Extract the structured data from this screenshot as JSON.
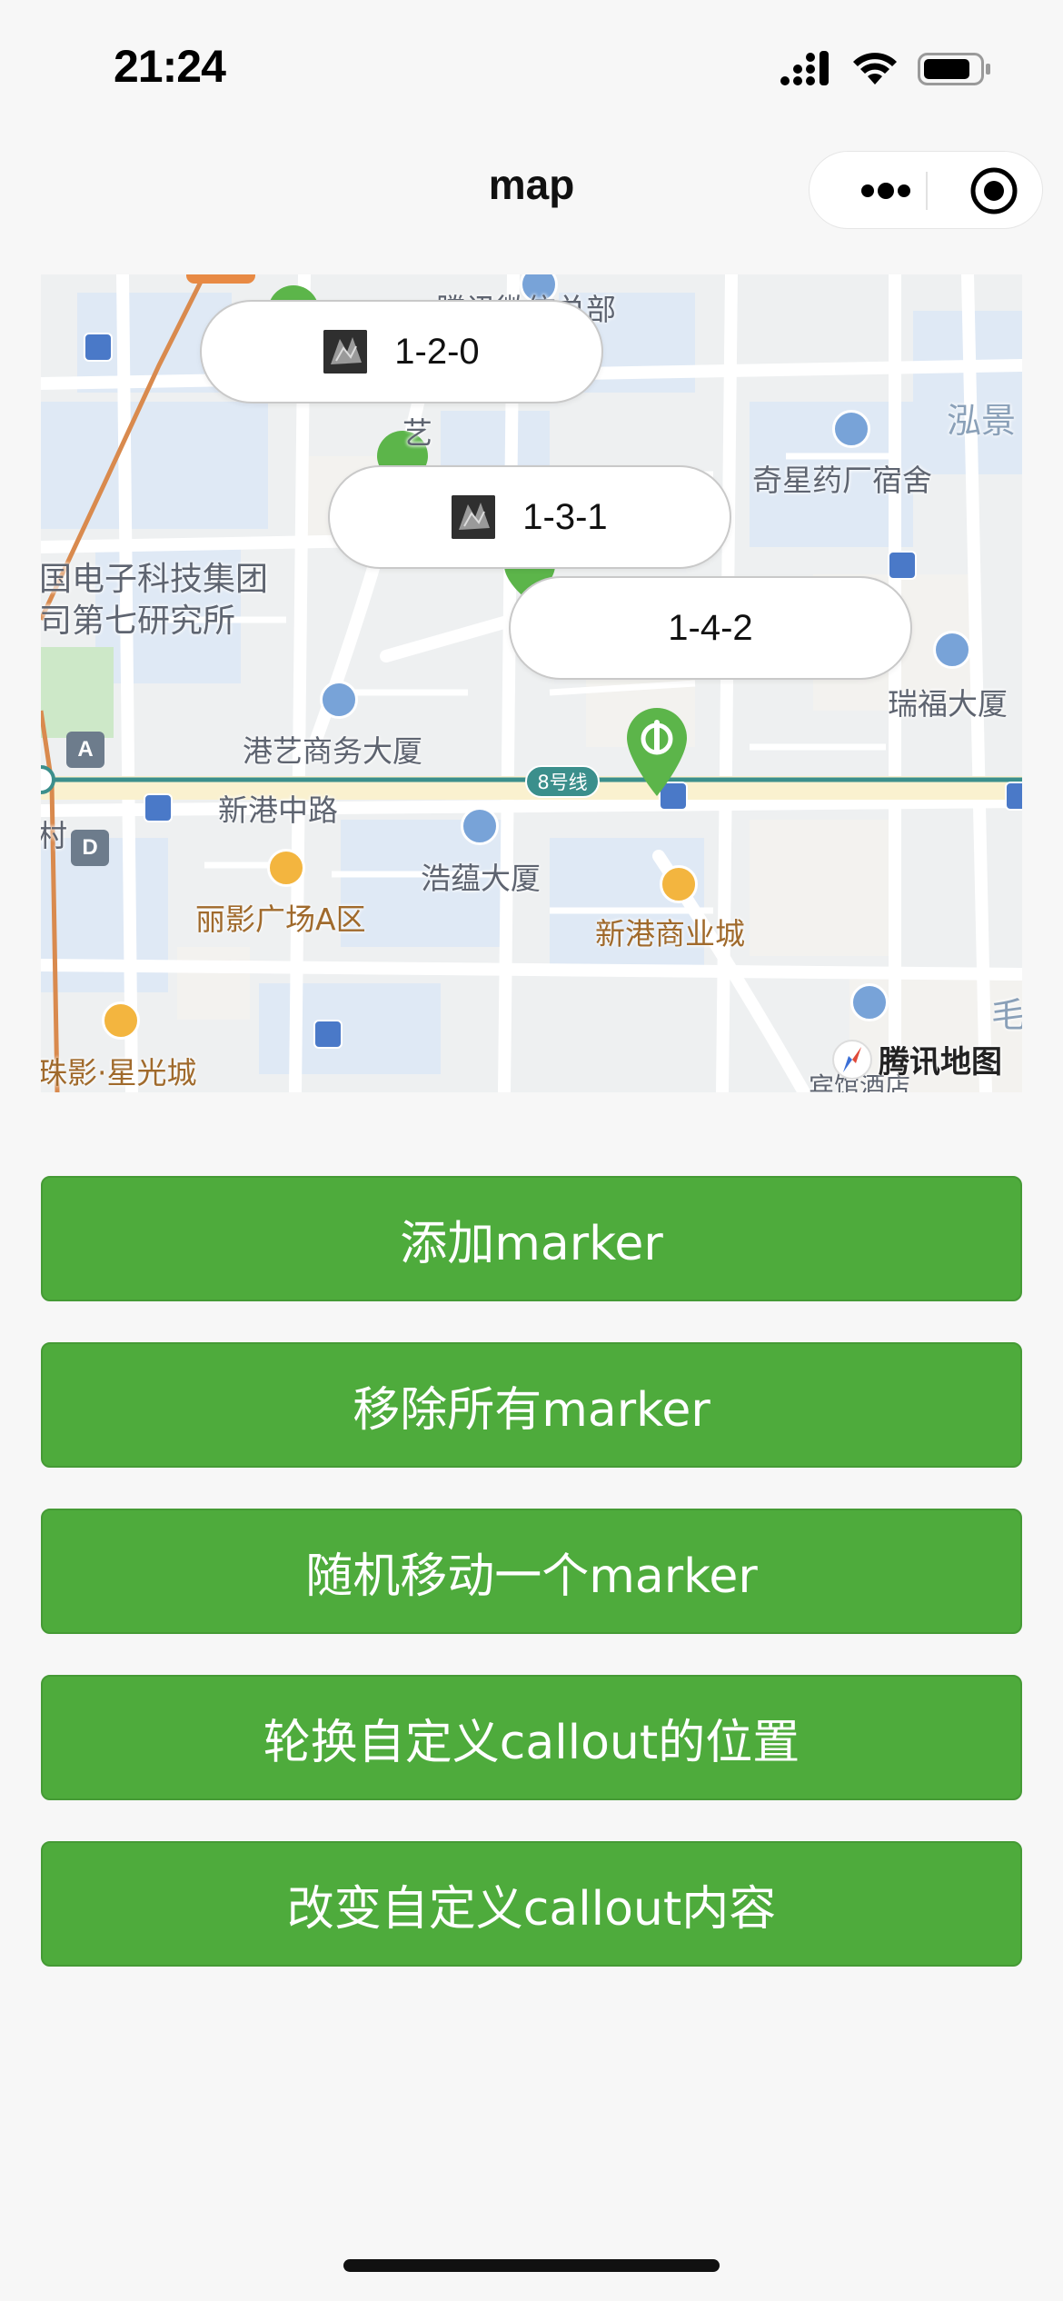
{
  "status_bar": {
    "time": "21:24",
    "icons": [
      "cellular-signal-icon",
      "wifi-icon",
      "battery-icon"
    ]
  },
  "nav": {
    "title": "map",
    "capsule_icons": [
      "more-icon",
      "target-icon"
    ]
  },
  "map": {
    "labels": {
      "top_building": "腾讯微信总部",
      "pharma_dorm": "奇星药厂宿舍",
      "hongjing": "泓景",
      "electronics_1": "国电子科技集团",
      "electronics_2": "司第七研究所",
      "ruifu": "瑞福大厦",
      "gangyi": "港艺商务大厦",
      "xingang_road": "新港中路",
      "cun": "村",
      "haoyun": "浩蕴大厦",
      "liying": "丽影广场A区",
      "xingang_mall": "新港商业城",
      "zhuying": "珠影·星光城",
      "mao": "毛",
      "hotel": "宾馆酒店",
      "yi": "艺"
    },
    "metro_line": "8号线",
    "exit_a": "A",
    "exit_d": "D",
    "callouts": [
      {
        "text": "1-2-0",
        "has_image": true
      },
      {
        "text": "1-3-1",
        "has_image": true
      },
      {
        "text": "1-4-2",
        "has_image": false
      }
    ],
    "logo": "腾讯地图",
    "colors": {
      "marker": "#5cb54a",
      "road": "#ffffff",
      "block": "#f2f1ee",
      "water_block": "#dfe9f5",
      "metro": "#3b8f8c",
      "rail": "#d98a4e"
    }
  },
  "buttons": {
    "add_marker": "添加marker",
    "remove_all": "移除所有marker",
    "move_random": "随机移动一个marker",
    "rotate_callout": "轮换自定义callout的位置",
    "change_callout": "改变自定义callout内容"
  },
  "theme": {
    "button_color": "#4eab3c",
    "page_bg": "#f7f7f7"
  }
}
